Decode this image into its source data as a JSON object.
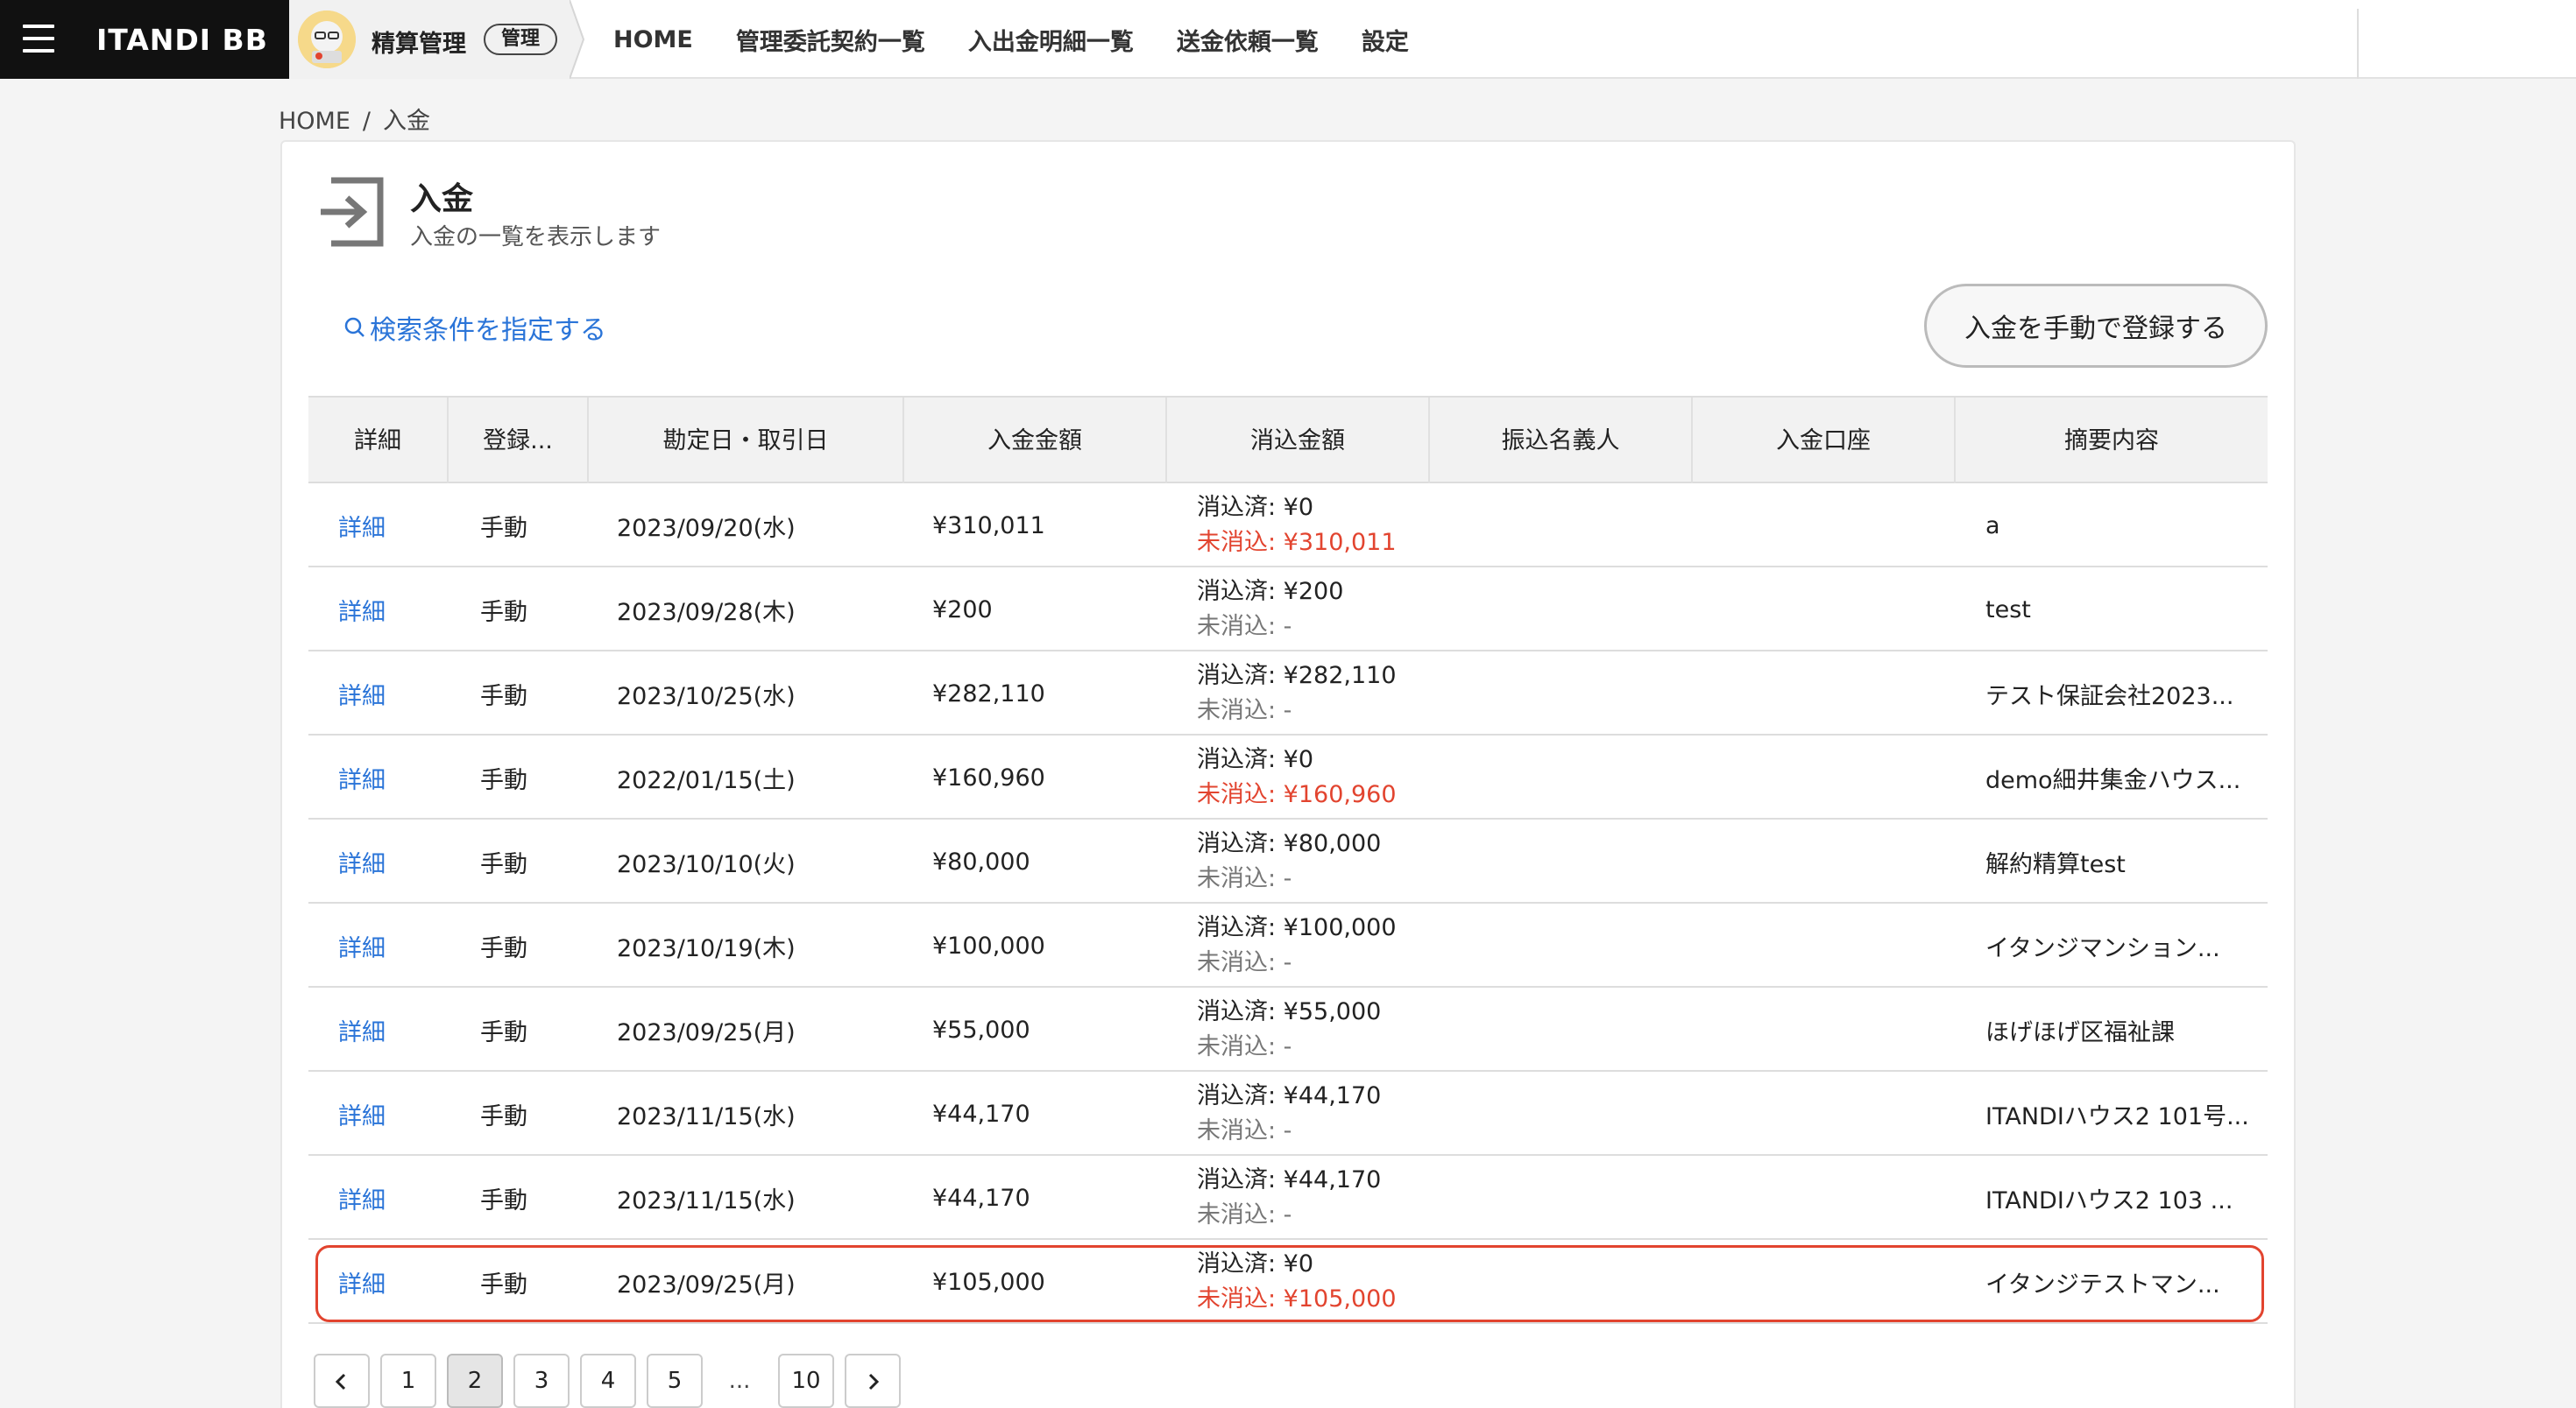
{
  "header": {
    "brand": "ITANDI BB",
    "app_name": "精算管理",
    "app_badge": "管理",
    "nav": [
      "HOME",
      "管理委託契約一覧",
      "入出金明細一覧",
      "送金依頼一覧",
      "設定"
    ]
  },
  "breadcrumb": {
    "home": "HOME",
    "separator": "/",
    "current": "入金"
  },
  "page": {
    "title": "入金",
    "subtitle": "入金の一覧を表示します",
    "search_link": "検索条件を指定する",
    "manual_button": "入金を手動で登録する"
  },
  "table": {
    "headers": [
      "詳細",
      "登録...",
      "勘定日・取引日",
      "入金金額",
      "消込金額",
      "振込名義人",
      "入金口座",
      "摘要内容"
    ],
    "rows": [
      {
        "detail": "詳細",
        "type": "手動",
        "date": "2023/09/20(水)",
        "amount": "¥310,011",
        "settled": "消込済: ¥0",
        "unsettled": "未消込: ¥310,011",
        "unsettled_alert": true,
        "payer": "",
        "account": "",
        "memo": "a"
      },
      {
        "detail": "詳細",
        "type": "手動",
        "date": "2023/09/28(木)",
        "amount": "¥200",
        "settled": "消込済: ¥200",
        "unsettled": "未消込: -",
        "unsettled_alert": false,
        "payer": "",
        "account": "",
        "memo": "test"
      },
      {
        "detail": "詳細",
        "type": "手動",
        "date": "2023/10/25(水)",
        "amount": "¥282,110",
        "settled": "消込済: ¥282,110",
        "unsettled": "未消込: -",
        "unsettled_alert": false,
        "payer": "",
        "account": "",
        "memo": "テスト保証会社2023..."
      },
      {
        "detail": "詳細",
        "type": "手動",
        "date": "2022/01/15(土)",
        "amount": "¥160,960",
        "settled": "消込済: ¥0",
        "unsettled": "未消込: ¥160,960",
        "unsettled_alert": true,
        "payer": "",
        "account": "",
        "memo": "demo細井集金ハウス..."
      },
      {
        "detail": "詳細",
        "type": "手動",
        "date": "2023/10/10(火)",
        "amount": "¥80,000",
        "settled": "消込済: ¥80,000",
        "unsettled": "未消込: -",
        "unsettled_alert": false,
        "payer": "",
        "account": "",
        "memo": "解約精算test"
      },
      {
        "detail": "詳細",
        "type": "手動",
        "date": "2023/10/19(木)",
        "amount": "¥100,000",
        "settled": "消込済: ¥100,000",
        "unsettled": "未消込: -",
        "unsettled_alert": false,
        "payer": "",
        "account": "",
        "memo": "イタンジマンション..."
      },
      {
        "detail": "詳細",
        "type": "手動",
        "date": "2023/09/25(月)",
        "amount": "¥55,000",
        "settled": "消込済: ¥55,000",
        "unsettled": "未消込: -",
        "unsettled_alert": false,
        "payer": "",
        "account": "",
        "memo": "ほげほげ区福祉課"
      },
      {
        "detail": "詳細",
        "type": "手動",
        "date": "2023/11/15(水)",
        "amount": "¥44,170",
        "settled": "消込済: ¥44,170",
        "unsettled": "未消込: -",
        "unsettled_alert": false,
        "payer": "",
        "account": "",
        "memo": "ITANDIハウス2 101号..."
      },
      {
        "detail": "詳細",
        "type": "手動",
        "date": "2023/11/15(水)",
        "amount": "¥44,170",
        "settled": "消込済: ¥44,170",
        "unsettled": "未消込: -",
        "unsettled_alert": false,
        "payer": "",
        "account": "",
        "memo": "ITANDIハウス2 103 ..."
      },
      {
        "detail": "詳細",
        "type": "手動",
        "date": "2023/09/25(月)",
        "amount": "¥105,000",
        "settled": "消込済: ¥0",
        "unsettled": "未消込: ¥105,000",
        "unsettled_alert": true,
        "payer": "",
        "account": "",
        "memo": "イタンジテストマン..."
      }
    ]
  },
  "pagination": {
    "prev_icon": "chevron-left-icon",
    "next_icon": "chevron-right-icon",
    "pages": [
      "1",
      "2",
      "3",
      "4",
      "5"
    ],
    "ellipsis": "...",
    "last": "10",
    "current": "2"
  },
  "colors": {
    "link": "#2a74d8",
    "alert": "#e2442f",
    "brand_bg": "#111111"
  }
}
